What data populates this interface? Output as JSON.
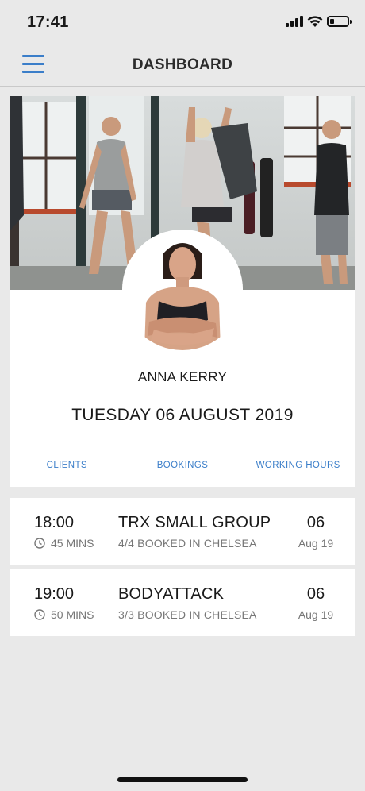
{
  "status": {
    "time": "17:41"
  },
  "nav": {
    "title": "DASHBOARD",
    "menu_icon": "hamburger-menu-icon"
  },
  "profile": {
    "name": "ANNA KERRY",
    "date": "TUESDAY 06 AUGUST 2019",
    "tabs": [
      {
        "label": "CLIENTS"
      },
      {
        "label": "BOOKINGS"
      },
      {
        "label": "WORKING HOURS"
      }
    ]
  },
  "bookings": [
    {
      "time": "18:00",
      "duration": "45 MINS",
      "title": "TRX SMALL GROUP",
      "subtitle": "4/4 BOOKED IN CHELSEA",
      "day": "06",
      "month": "Aug 19"
    },
    {
      "time": "19:00",
      "duration": "50 MINS",
      "title": "BODYATTACK",
      "subtitle": "3/3 BOOKED IN CHELSEA",
      "day": "06",
      "month": "Aug 19"
    }
  ],
  "colors": {
    "accent": "#3b7ec9",
    "background": "#e9e9e9",
    "card": "#ffffff",
    "muted_text": "#777777"
  }
}
